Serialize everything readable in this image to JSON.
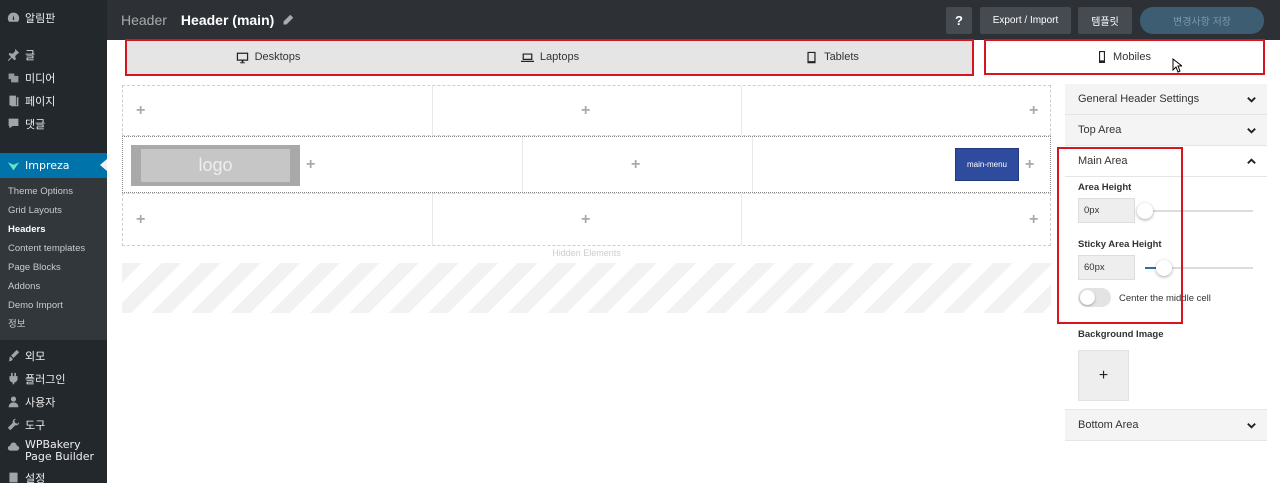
{
  "sidebar": {
    "items": [
      {
        "label": "알림판",
        "icon": "dashboard-icon"
      },
      {
        "label": "글",
        "icon": "pin-icon"
      },
      {
        "label": "미디어",
        "icon": "media-icon"
      },
      {
        "label": "페이지",
        "icon": "page-icon"
      },
      {
        "label": "댓글",
        "icon": "comment-icon"
      }
    ],
    "active": {
      "label": "Impreza",
      "icon": "impreza-icon"
    },
    "submenu": [
      "Theme Options",
      "Grid Layouts",
      "Headers",
      "Content templates",
      "Page Blocks",
      "Addons",
      "Demo Import",
      "정보"
    ],
    "current_sub": "Headers",
    "items_after": [
      {
        "label": "외모",
        "icon": "brush-icon"
      },
      {
        "label": "플러그인",
        "icon": "plugin-icon"
      },
      {
        "label": "사용자",
        "icon": "user-icon"
      },
      {
        "label": "도구",
        "icon": "wrench-icon"
      },
      {
        "label": "WPBakery Page Builder",
        "icon": "cloud-icon"
      },
      {
        "label": "설정",
        "icon": "settings-icon"
      }
    ]
  },
  "topbar": {
    "crumb": "Header",
    "title": "Header (main)",
    "help_label": "?",
    "export_label": "Export / Import",
    "template_label": "템플릿",
    "save_label": "변경사항 저장"
  },
  "tabs": [
    {
      "label": "Desktops",
      "icon": "desktop-icon"
    },
    {
      "label": "Laptops",
      "icon": "laptop-icon"
    },
    {
      "label": "Tablets",
      "icon": "tablet-icon"
    },
    {
      "label": "Mobiles",
      "icon": "mobile-icon",
      "active": true
    }
  ],
  "canvas": {
    "logo_text": "logo",
    "menu_text": "main-menu",
    "add_symbol": "+",
    "hidden_label": "Hidden Elements"
  },
  "panel": {
    "sections": [
      "General Header Settings",
      "Top Area",
      "Main Area",
      "Bottom Area"
    ],
    "open_section": "Main Area",
    "area_height_label": "Area Height",
    "area_height_value": "0px",
    "area_height_level": 0,
    "sticky_height_label": "Sticky Area Height",
    "sticky_height_value": "60px",
    "sticky_height_level": 0.18,
    "center_toggle_label": "Center the middle cell",
    "center_toggle_on": false,
    "bg_image_label": "Background Image",
    "bg_add_symbol": "+"
  },
  "colors": {
    "highlight_box": "#d6151f",
    "accent": "#0073aa",
    "menu_element": "#2f4b9e"
  }
}
